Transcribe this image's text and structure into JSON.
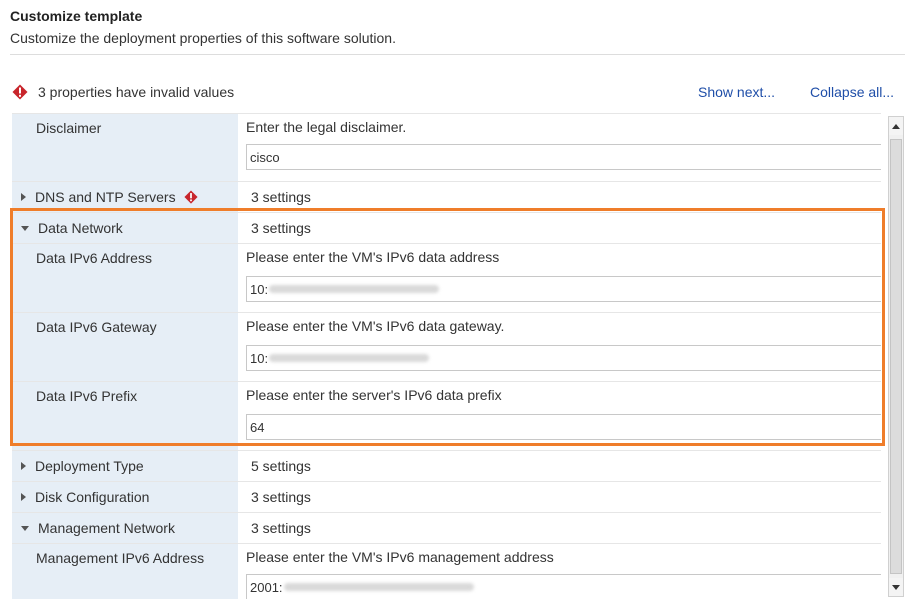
{
  "header": {
    "title": "Customize template",
    "subtitle": "Customize the deployment properties of this software solution."
  },
  "warning": {
    "text": "3 properties have invalid values",
    "icon": "error-diamond-icon",
    "color": "#c8252c"
  },
  "actions": {
    "show_next": "Show next...",
    "collapse_all": "Collapse all..."
  },
  "rows": {
    "disclaimer": {
      "label": "Disclaimer",
      "description": "Enter the legal disclaimer.",
      "value": "cisco"
    },
    "dns_ntp": {
      "label": "DNS and NTP Servers",
      "summary": "3 settings"
    },
    "data_network": {
      "label": "Data Network",
      "summary": "3 settings"
    },
    "data_ipv6_address": {
      "label": "Data IPv6 Address",
      "description": "Please enter the VM's IPv6 data address",
      "value": "10:"
    },
    "data_ipv6_gateway": {
      "label": "Data IPv6 Gateway",
      "description": "Please enter the VM's IPv6 data gateway.",
      "value": "10:"
    },
    "data_ipv6_prefix": {
      "label": "Data IPv6 Prefix",
      "description": "Please enter the server's IPv6 data prefix",
      "value": "64"
    },
    "deployment_type": {
      "label": "Deployment Type",
      "summary": "5 settings"
    },
    "disk_configuration": {
      "label": "Disk Configuration",
      "summary": "3 settings"
    },
    "management_network": {
      "label": "Management Network",
      "summary": "3 settings"
    },
    "management_ipv6_address": {
      "label": "Management IPv6 Address",
      "description": "Please enter the VM's IPv6 management address",
      "value": "2001:"
    }
  },
  "colors": {
    "label_bg": "#e6eef6",
    "highlight": "#ef7d2a",
    "link": "#1f4ea8"
  }
}
